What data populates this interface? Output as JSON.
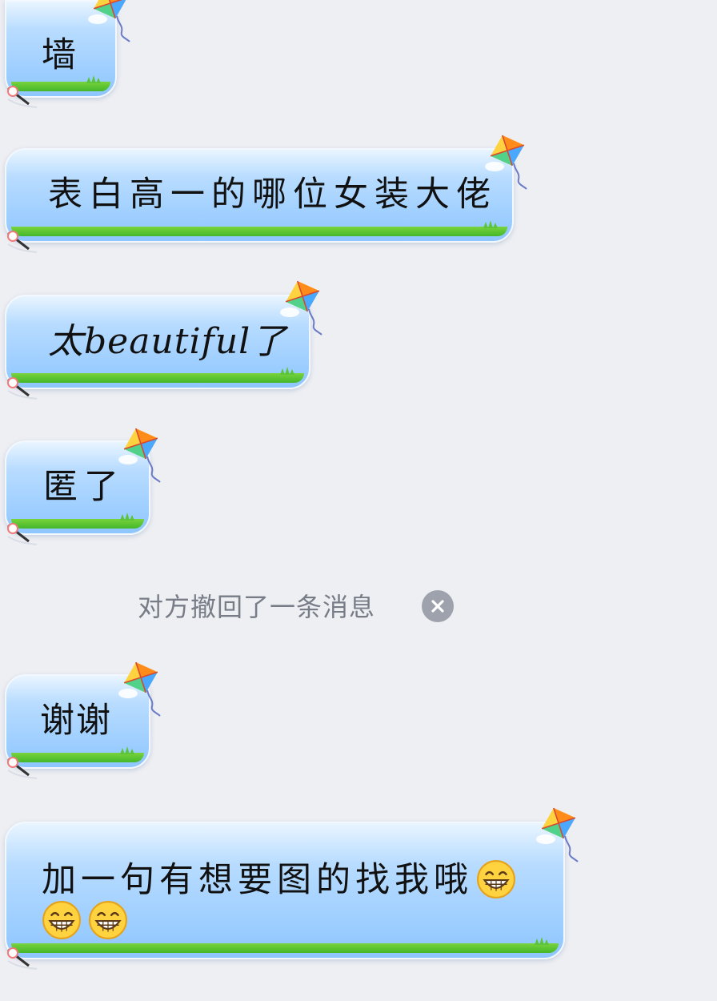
{
  "messages": [
    {
      "text": "墙"
    },
    {
      "text": "表白高一的哪位女装大佬"
    },
    {
      "text": "太beautiful了"
    },
    {
      "text": "匿了"
    },
    {
      "text": "谢谢"
    },
    {
      "text": "加一句有想要图的找我哦"
    }
  ],
  "system_notice": {
    "text": "对方撤回了一条消息"
  },
  "emoji": {
    "name": "grinning-face-emoji",
    "count_in_last_message": 3
  },
  "colors": {
    "background": "#eeeff3",
    "bubble_top": "#e9f5ff",
    "bubble_bottom": "#8ec6ff",
    "grass": "#44b72a",
    "notice_text": "#777c87"
  }
}
